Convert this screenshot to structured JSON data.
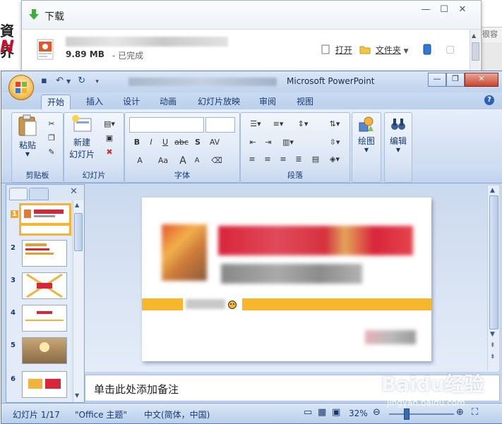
{
  "background_page": {
    "logo_line1": "資界",
    "logo_line2": "N",
    "right_text": "很容"
  },
  "download_window": {
    "title": "下载",
    "minimize": "—",
    "maximize": "☐",
    "close": "✕",
    "item": {
      "size": "9.89 MB",
      "status": "- 已完成",
      "open_label": "打开",
      "folder_label": "文件夹"
    }
  },
  "ppt": {
    "app_name": "Microsoft PowerPoint",
    "window_buttons": {
      "minimize": "—",
      "restore": "❐",
      "close": "✕"
    },
    "tabs": [
      "开始",
      "插入",
      "设计",
      "动画",
      "幻灯片放映",
      "审阅",
      "视图"
    ],
    "active_tab": "开始",
    "groups": {
      "clipboard": {
        "label": "剪贴板",
        "paste": "粘贴"
      },
      "slides": {
        "label": "幻灯片",
        "new_slide_line1": "新建",
        "new_slide_line2": "幻灯片"
      },
      "font": {
        "label": "字体",
        "bold": "B",
        "italic": "I",
        "underline": "U",
        "strike": "abc",
        "shadow": "S",
        "spacing": "AV",
        "grow": "A",
        "size_aa": "Aa",
        "bigger": "A",
        "smaller": "A"
      },
      "paragraph": {
        "label": "段落"
      },
      "drawing": {
        "label": "绘图"
      },
      "editing": {
        "label": "编辑"
      }
    },
    "slide_numbers": [
      "1",
      "2",
      "3",
      "4",
      "5",
      "6"
    ],
    "notes_placeholder": "单击此处添加备注",
    "status": {
      "slide": "幻灯片 1/17",
      "theme": "\"Office 主题\"",
      "language": "中文(简体，中国)",
      "zoom": "32%"
    }
  },
  "watermark": {
    "text": "Baidu经验",
    "url": "jingyan.baidu.com"
  }
}
